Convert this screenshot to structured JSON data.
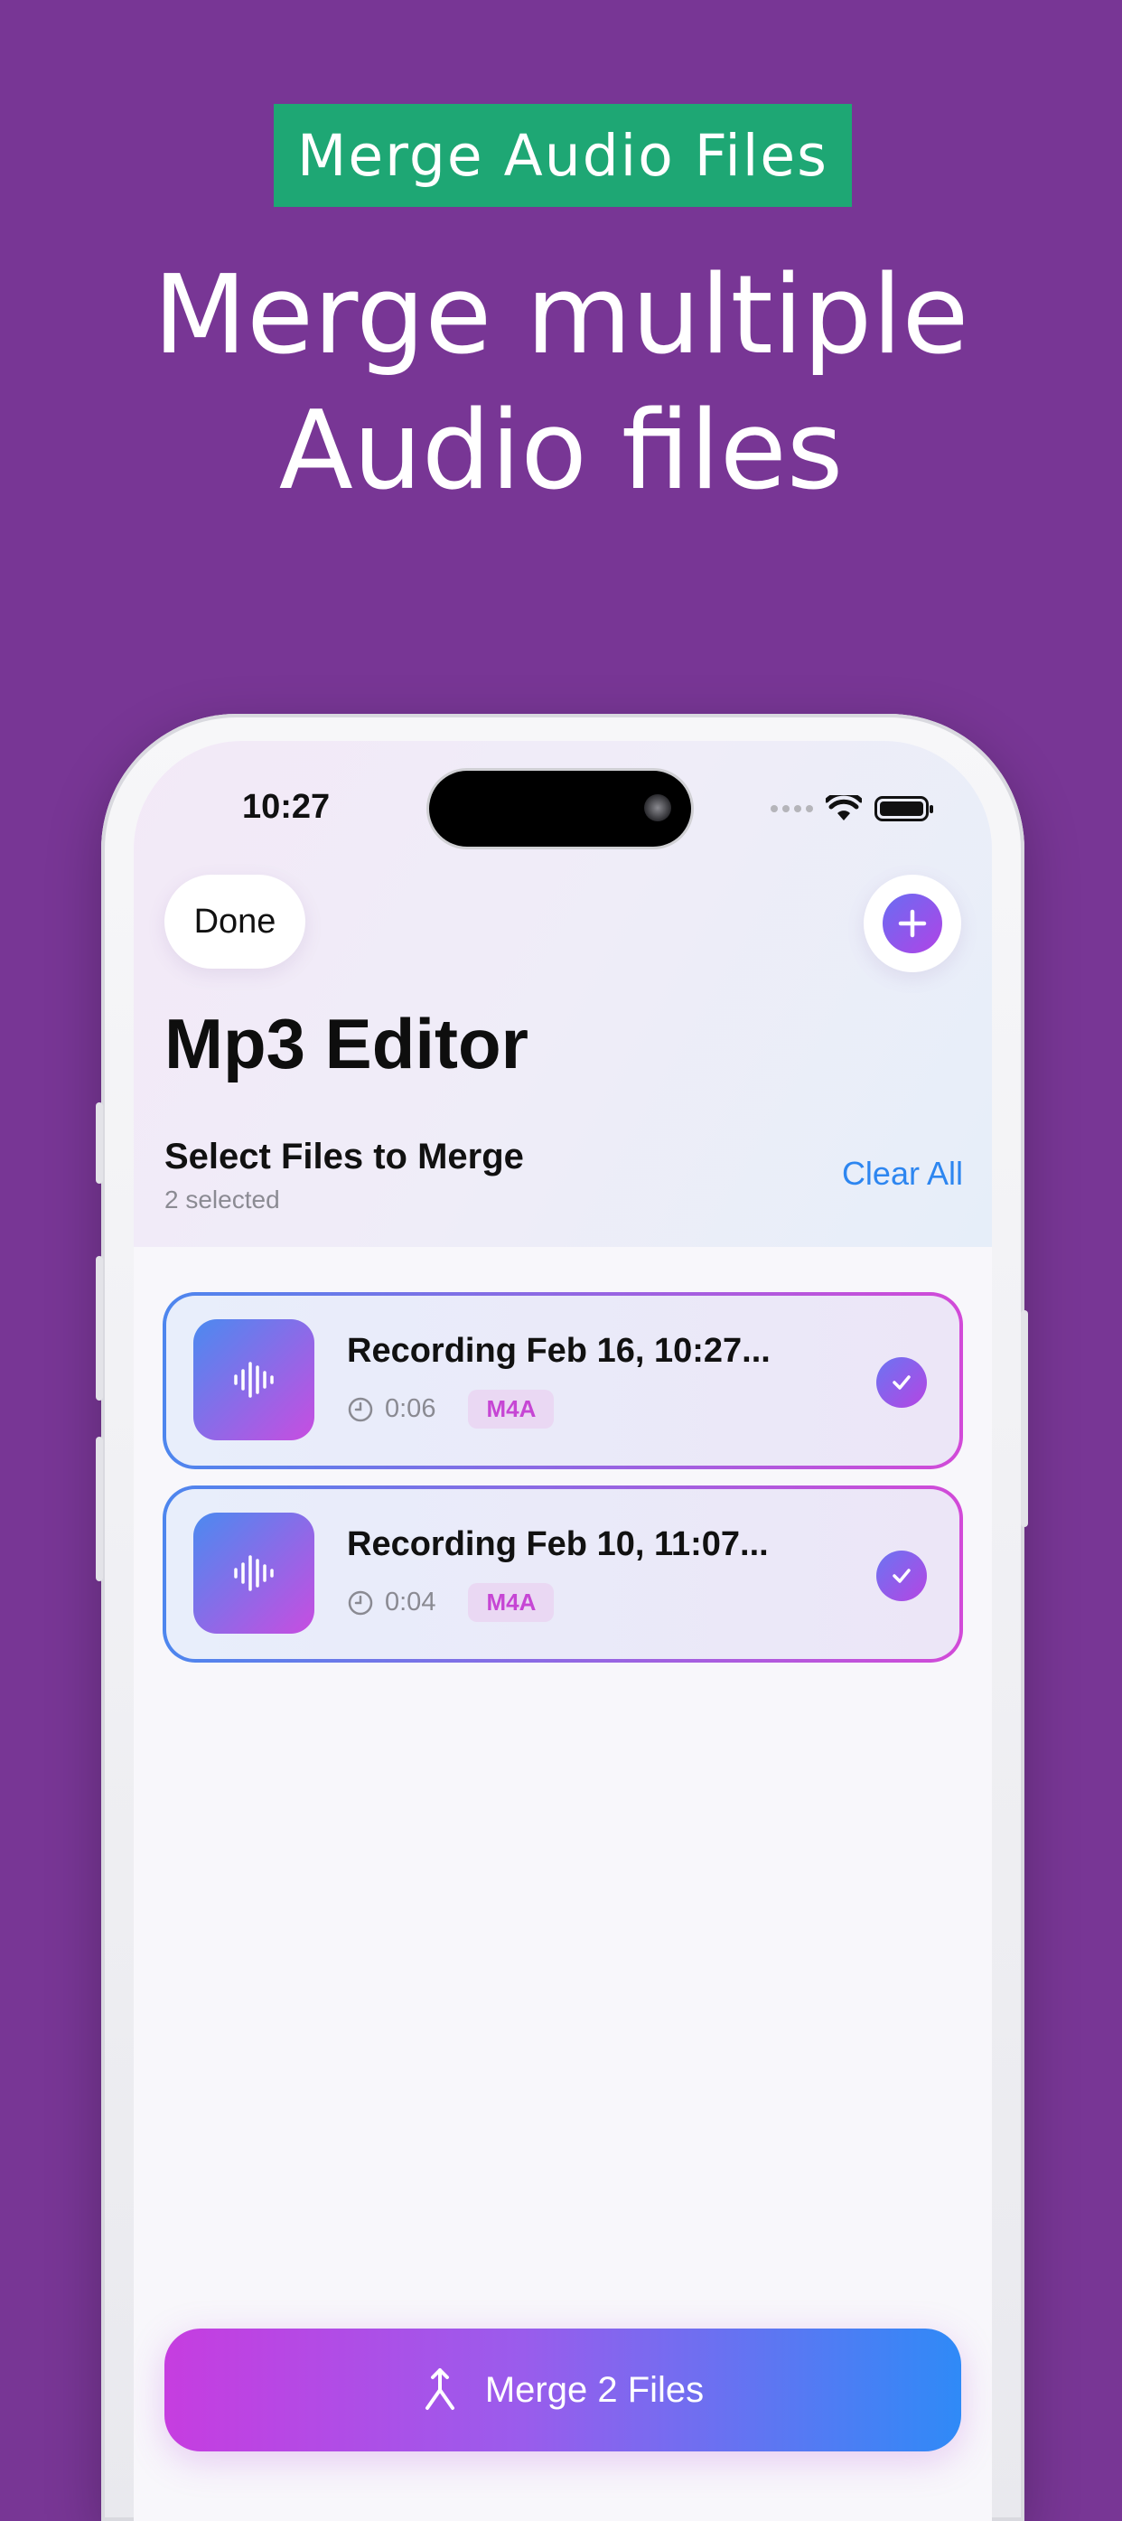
{
  "promo": {
    "badge": "Merge Audio Files",
    "headline_line1": "Merge multiple",
    "headline_line2": "Audio files"
  },
  "status_bar": {
    "time": "10:27"
  },
  "nav": {
    "done_label": "Done",
    "add_icon": "plus-icon"
  },
  "app": {
    "title": "Mp3 Editor"
  },
  "section": {
    "title": "Select Files to Merge",
    "subtitle": "2 selected",
    "clear_all": "Clear All"
  },
  "files": [
    {
      "name": "Recording Feb 16, 10:27...",
      "duration": "0:06",
      "format": "M4A",
      "selected": true
    },
    {
      "name": "Recording Feb 10, 11:07...",
      "duration": "0:04",
      "format": "M4A",
      "selected": true
    }
  ],
  "merge_button": {
    "label": "Merge 2 Files"
  },
  "colors": {
    "background": "#783695",
    "badge": "#1ea774",
    "accent_blue": "#2d86f0",
    "accent_purple": "#b044e6"
  }
}
